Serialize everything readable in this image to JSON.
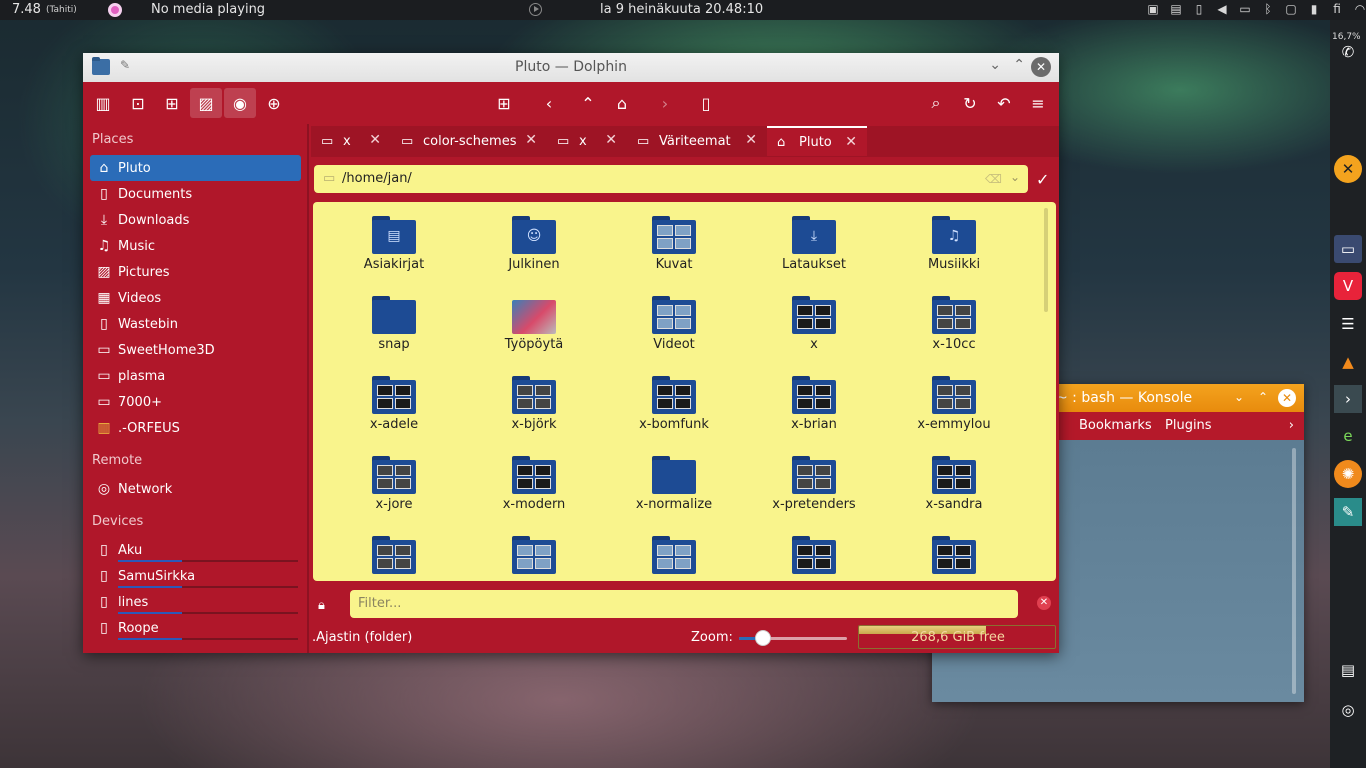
{
  "top_panel": {
    "time": "7.48",
    "timezone": "(Tahiti)",
    "media": "No media playing",
    "date": "la 9 heinäkuuta 20.48:10",
    "language": "fi"
  },
  "dock": {
    "battery": "16,7%"
  },
  "konsole": {
    "title": "~ : bash — Konsole",
    "menu": [
      "Bookmarks",
      "Plugins"
    ]
  },
  "dolphin": {
    "title": "Pluto — Dolphin",
    "sidebar": {
      "places_header": "Places",
      "places": [
        {
          "label": "Pluto",
          "icon": "home-icon"
        },
        {
          "label": "Documents",
          "icon": "documents-icon"
        },
        {
          "label": "Downloads",
          "icon": "downloads-icon"
        },
        {
          "label": "Music",
          "icon": "music-icon"
        },
        {
          "label": "Pictures",
          "icon": "pictures-icon"
        },
        {
          "label": "Videos",
          "icon": "videos-icon"
        },
        {
          "label": "Wastebin",
          "icon": "trash-icon"
        },
        {
          "label": "SweetHome3D",
          "icon": "folder-icon"
        },
        {
          "label": "plasma",
          "icon": "folder-icon"
        },
        {
          "label": "7000+",
          "icon": "folder-icon"
        },
        {
          "label": ".-ORFEUS",
          "icon": "books-icon"
        }
      ],
      "remote_header": "Remote",
      "remote": [
        {
          "label": "Network",
          "icon": "network-icon"
        }
      ],
      "devices_header": "Devices",
      "devices": [
        {
          "label": "Aku",
          "icon": "drive-icon"
        },
        {
          "label": "SamuSirkka",
          "icon": "drive-icon"
        },
        {
          "label": "lines",
          "icon": "drive-icon"
        },
        {
          "label": "Roope",
          "icon": "drive-icon"
        }
      ]
    },
    "tabs": [
      {
        "label": "x"
      },
      {
        "label": "color-schemes"
      },
      {
        "label": "x"
      },
      {
        "label": "Väriteemat"
      },
      {
        "label": "Pluto"
      }
    ],
    "location": "/home/jan/",
    "files": [
      {
        "name": "Asiakirjat",
        "kind": "docs"
      },
      {
        "name": "Julkinen",
        "kind": "public"
      },
      {
        "name": "Kuvat",
        "kind": "photo"
      },
      {
        "name": "Lataukset",
        "kind": "download"
      },
      {
        "name": "Musiikki",
        "kind": "music"
      },
      {
        "name": "snap",
        "kind": "plain"
      },
      {
        "name": "Työpöytä",
        "kind": "wallpaper"
      },
      {
        "name": "Videot",
        "kind": "photo"
      },
      {
        "name": "x",
        "kind": "dark"
      },
      {
        "name": "x-10cc",
        "kind": "thumbs"
      },
      {
        "name": "x-adele",
        "kind": "dark"
      },
      {
        "name": "x-björk",
        "kind": "thumbs"
      },
      {
        "name": "x-bomfunk",
        "kind": "dark"
      },
      {
        "name": "x-brian",
        "kind": "dark"
      },
      {
        "name": "x-emmylou",
        "kind": "thumbs"
      },
      {
        "name": "x-jore",
        "kind": "thumbs"
      },
      {
        "name": "x-modern",
        "kind": "dark"
      },
      {
        "name": "x-normalize",
        "kind": "plain"
      },
      {
        "name": "x-pretenders",
        "kind": "thumbs"
      },
      {
        "name": "x-sandra",
        "kind": "dark"
      },
      {
        "name": "",
        "kind": "thumbs"
      },
      {
        "name": "",
        "kind": "photo"
      },
      {
        "name": "",
        "kind": "photo"
      },
      {
        "name": "",
        "kind": "dark"
      },
      {
        "name": "",
        "kind": "dark"
      }
    ],
    "filter_placeholder": "Filter...",
    "status": ".Ajastin (folder)",
    "zoom_label": "Zoom:",
    "zoom_level": 0.22,
    "free_space": "268,6 GiB free",
    "disk_used_fraction": 0.65
  },
  "colors": {
    "window_accent": "#b0172a",
    "view_background": "#f9f48c",
    "selection": "#2b6cb8",
    "folder": "#1d4b94",
    "konsole_title": "#f4a31e"
  }
}
